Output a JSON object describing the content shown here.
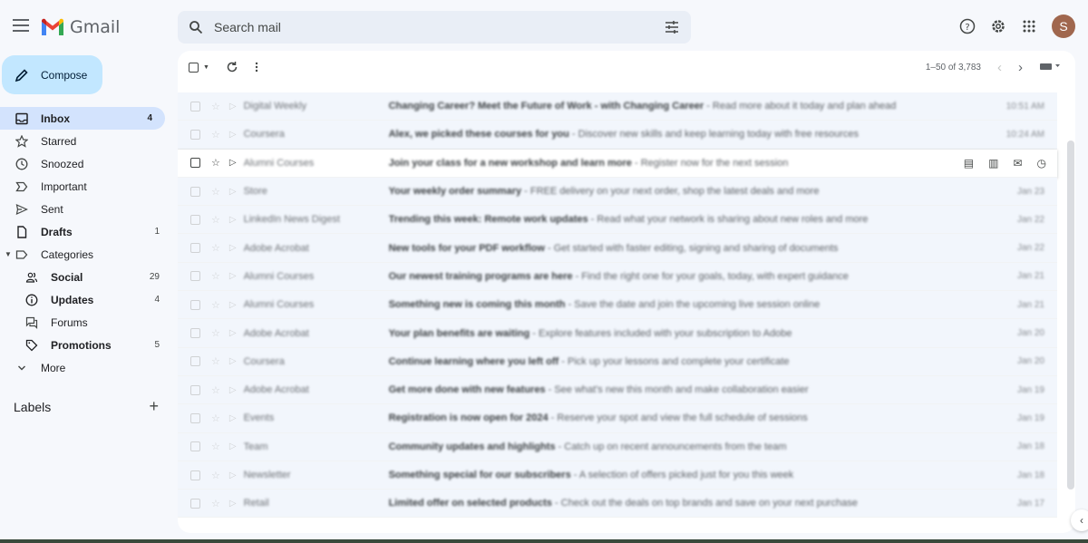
{
  "app": {
    "name": "Gmail"
  },
  "search": {
    "placeholder": "Search mail"
  },
  "profile": {
    "initial": "S",
    "color": "#a0674e"
  },
  "compose": {
    "label": "Compose"
  },
  "nav": {
    "inbox": {
      "label": "Inbox",
      "count": "4"
    },
    "starred": {
      "label": "Starred"
    },
    "snoozed": {
      "label": "Snoozed"
    },
    "important": {
      "label": "Important"
    },
    "sent": {
      "label": "Sent"
    },
    "drafts": {
      "label": "Drafts",
      "count": "1"
    },
    "categories": {
      "label": "Categories"
    },
    "social": {
      "label": "Social",
      "count": "29"
    },
    "updates": {
      "label": "Updates",
      "count": "4"
    },
    "forums": {
      "label": "Forums"
    },
    "promotions": {
      "label": "Promotions",
      "count": "5"
    },
    "more": {
      "label": "More"
    }
  },
  "labels": {
    "title": "Labels"
  },
  "pager": {
    "range": "1–50 of 3,783"
  },
  "emails": [
    {
      "sender": "Digital Weekly",
      "subject": "Changing Career? Meet the Future of Work - with Changing Career",
      "snippet": " - Read more about it today and plan ahead",
      "date": "10:51 AM"
    },
    {
      "sender": "Coursera",
      "subject": "Alex, we picked these courses for you",
      "snippet": " - Discover new skills and keep learning today with free resources",
      "date": "10:24 AM"
    },
    {
      "sender": "Alumni Courses",
      "subject": "Join your class for a new workshop and learn more",
      "snippet": " - Register now for the next session",
      "date": ""
    },
    {
      "sender": "Store",
      "subject": "Your weekly order summary",
      "snippet": " - FREE delivery on your next order, shop the latest deals and more",
      "date": "Jan 23"
    },
    {
      "sender": "LinkedIn News Digest",
      "subject": "Trending this week: Remote work updates",
      "snippet": " - Read what your network is sharing about new roles and more",
      "date": "Jan 22"
    },
    {
      "sender": "Adobe Acrobat",
      "subject": "New tools for your PDF workflow",
      "snippet": " - Get started with faster editing, signing and sharing of documents",
      "date": "Jan 22"
    },
    {
      "sender": "Alumni Courses",
      "subject": "Our newest training programs are here",
      "snippet": " - Find the right one for your goals, today, with expert guidance",
      "date": "Jan 21"
    },
    {
      "sender": "Alumni Courses",
      "subject": "Something new is coming this month",
      "snippet": " - Save the date and join the upcoming live session online",
      "date": "Jan 21"
    },
    {
      "sender": "Adobe Acrobat",
      "subject": "Your plan benefits are waiting",
      "snippet": " - Explore features included with your subscription to Adobe",
      "date": "Jan 20"
    },
    {
      "sender": "Coursera",
      "subject": "Continue learning where you left off",
      "snippet": " - Pick up your lessons and complete your certificate",
      "date": "Jan 20"
    },
    {
      "sender": "Adobe Acrobat",
      "subject": "Get more done with new features",
      "snippet": " - See what's new this month and make collaboration easier",
      "date": "Jan 19"
    },
    {
      "sender": "Events",
      "subject": "Registration is now open for 2024",
      "snippet": " - Reserve your spot and view the full schedule of sessions",
      "date": "Jan 19"
    },
    {
      "sender": "Team",
      "subject": "Community updates and highlights",
      "snippet": " - Catch up on recent announcements from the team",
      "date": "Jan 18"
    },
    {
      "sender": "Newsletter",
      "subject": "Something special for our subscribers",
      "snippet": " - A selection of offers picked just for you this week",
      "date": "Jan 18"
    },
    {
      "sender": "Retail",
      "subject": "Limited offer on selected products",
      "snippet": " - Check out the deals on top brands and save on your next purchase",
      "date": "Jan 17"
    }
  ]
}
